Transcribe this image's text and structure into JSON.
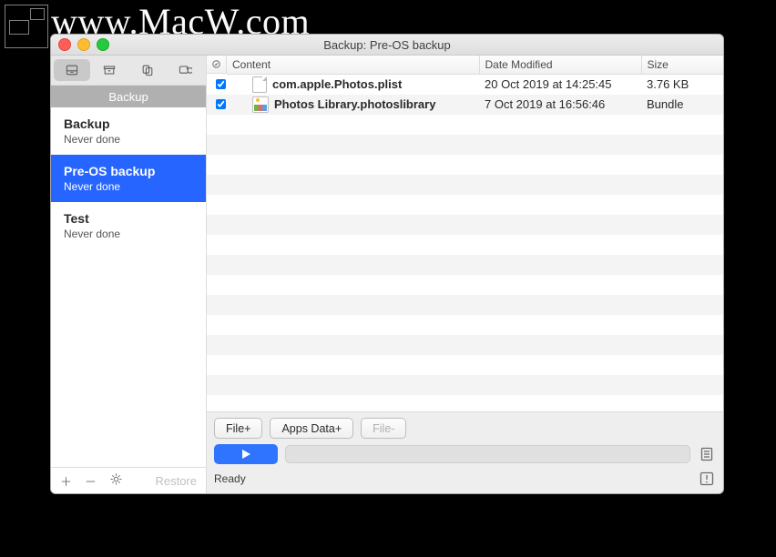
{
  "watermark": "www.MacW.com",
  "window": {
    "title": "Backup: Pre-OS backup"
  },
  "sidebar": {
    "heading": "Backup",
    "items": [
      {
        "name": "Backup",
        "sub": "Never done",
        "selected": false
      },
      {
        "name": "Pre-OS backup",
        "sub": "Never done",
        "selected": true
      },
      {
        "name": "Test",
        "sub": "Never done",
        "selected": false
      }
    ],
    "restore_label": "Restore"
  },
  "table": {
    "columns": {
      "content": "Content",
      "date": "Date Modified",
      "size": "Size"
    },
    "rows": [
      {
        "checked": true,
        "icon": "document",
        "name": "com.apple.Photos.plist",
        "date": "20 Oct 2019 at 14:25:45",
        "size": "3.76 KB"
      },
      {
        "checked": true,
        "icon": "library",
        "name": "Photos Library.photoslibrary",
        "date": "7 Oct 2019 at 16:56:46",
        "size": "Bundle"
      }
    ]
  },
  "toolbar": {
    "file_plus": "File+",
    "apps_data_plus": "Apps Data+",
    "file_minus": "File-"
  },
  "status": "Ready"
}
